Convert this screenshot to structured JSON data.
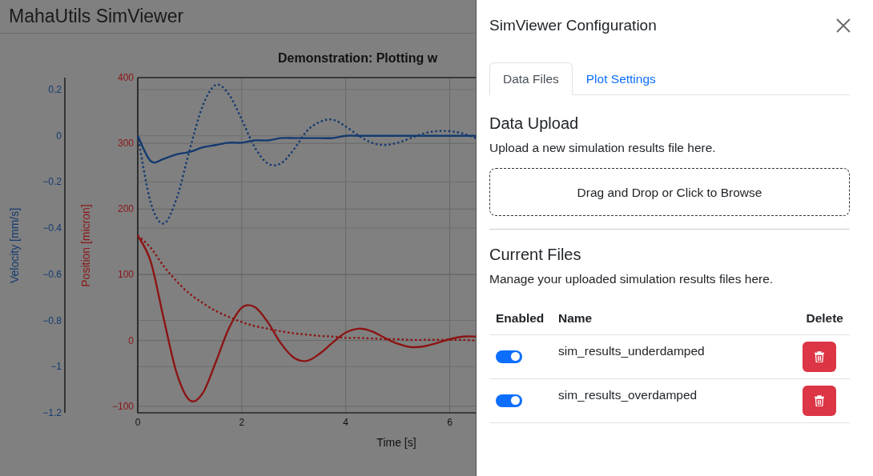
{
  "app": {
    "title": "MahaUtils SimViewer"
  },
  "plot": {
    "position_chart": {
      "chart_data": {
        "type": "line",
        "title": "Demonstration: Plotting w",
        "xlabel": "Time [s]",
        "ylabel": "Position [micron]",
        "x": [
          0,
          0.25,
          0.5,
          0.75,
          1,
          1.25,
          1.5,
          1.75,
          2,
          2.25,
          2.5,
          2.75,
          3,
          3.25,
          3.5,
          3.75,
          4,
          4.25,
          4.5,
          4.75,
          5,
          5.25,
          5.5,
          5.75,
          6,
          6.25,
          6.5
        ],
        "series": [
          {
            "color": "#8c1414",
            "line_style": "solid",
            "values": [
              160,
              120,
              33,
              -50,
              -91,
              -80,
              -33,
              18,
              50,
              51,
              28,
              -4,
              -26,
              -31,
              -20,
              -3,
              12,
              18,
              14,
              4,
              -5,
              -10,
              -9,
              -4,
              2,
              6,
              6
            ]
          },
          {
            "color": "#8c1414",
            "line_style": "dotted",
            "values": [
              160,
              141,
              113,
              90,
              71,
              57,
              45,
              36,
              28,
              22,
              18,
              14,
              11,
              9,
              7,
              6,
              4,
              4,
              3,
              2,
              2,
              1,
              1,
              1,
              1,
              1,
              0
            ]
          }
        ],
        "xlim": [
          0,
          6.5
        ],
        "ylim": [
          -110,
          400
        ],
        "xticks": [
          0,
          2,
          4,
          6
        ],
        "yticks": [
          {
            "value": -100,
            "label": "−100"
          },
          0,
          100,
          200,
          300,
          400
        ]
      }
    },
    "velocity_chart": {
      "chart_data": {
        "type": "line",
        "ylabel": "Velocity [mm/s]",
        "x": [
          0,
          0.25,
          0.5,
          0.75,
          1,
          1.25,
          1.5,
          1.75,
          2,
          2.25,
          2.5,
          2.75,
          3,
          3.25,
          3.5,
          3.75,
          4,
          4.25,
          4.5,
          4.75,
          5,
          5.25,
          5.5,
          5.75,
          6,
          6.25,
          6.5
        ],
        "series": [
          {
            "color": "#143a70",
            "line_style": "dotted",
            "values": [
              0,
              -0.29,
              -0.38,
              -0.27,
              -0.06,
              0.13,
              0.22,
              0.18,
              0.07,
              -0.05,
              -0.12,
              -0.12,
              -0.06,
              0.02,
              0.06,
              0.07,
              0.04,
              0,
              -0.03,
              -0.04,
              -0.03,
              -0.01,
              0.01,
              0.02,
              0.02,
              0.01,
              -0.01
            ]
          },
          {
            "color": "#143a70",
            "line_style": "solid",
            "values": [
              0,
              -0.11,
              -0.1,
              -0.08,
              -0.07,
              -0.05,
              -0.04,
              -0.03,
              -0.03,
              -0.02,
              -0.02,
              -0.01,
              -0.01,
              -0.01,
              -0.01,
              -0.01,
              0,
              0,
              0,
              0,
              0,
              0,
              0,
              0,
              0,
              0,
              0
            ]
          }
        ],
        "xlim": [
          0,
          6.5
        ],
        "ylim": [
          -1.2,
          0.252
        ],
        "yticks": [
          {
            "value": -1.2,
            "label": "−1.2"
          },
          {
            "value": -1,
            "label": "−1"
          },
          {
            "value": -0.8,
            "label": "−0.8"
          },
          {
            "value": -0.6,
            "label": "−0.6"
          },
          {
            "value": -0.4,
            "label": "−0.4"
          },
          {
            "value": -0.2,
            "label": "−0.2"
          },
          0,
          0.2
        ]
      }
    }
  },
  "config_panel": {
    "title": "SimViewer Configuration",
    "tabs": [
      {
        "label": "Data Files",
        "selected": true
      },
      {
        "label": "Plot Settings",
        "selected": false
      }
    ],
    "upload": {
      "heading": "Data Upload",
      "description": "Upload a new simulation results file here.",
      "dropzone_label": "Drag and Drop or Click to Browse"
    },
    "files": {
      "heading": "Current Files",
      "description": "Manage your uploaded simulation results files here.",
      "columns": [
        "Enabled",
        "Name",
        "Delete"
      ],
      "rows": [
        {
          "enabled": true,
          "name": "sim_results_underdamped"
        },
        {
          "enabled": true,
          "name": "sim_results_overdamped"
        }
      ]
    }
  }
}
